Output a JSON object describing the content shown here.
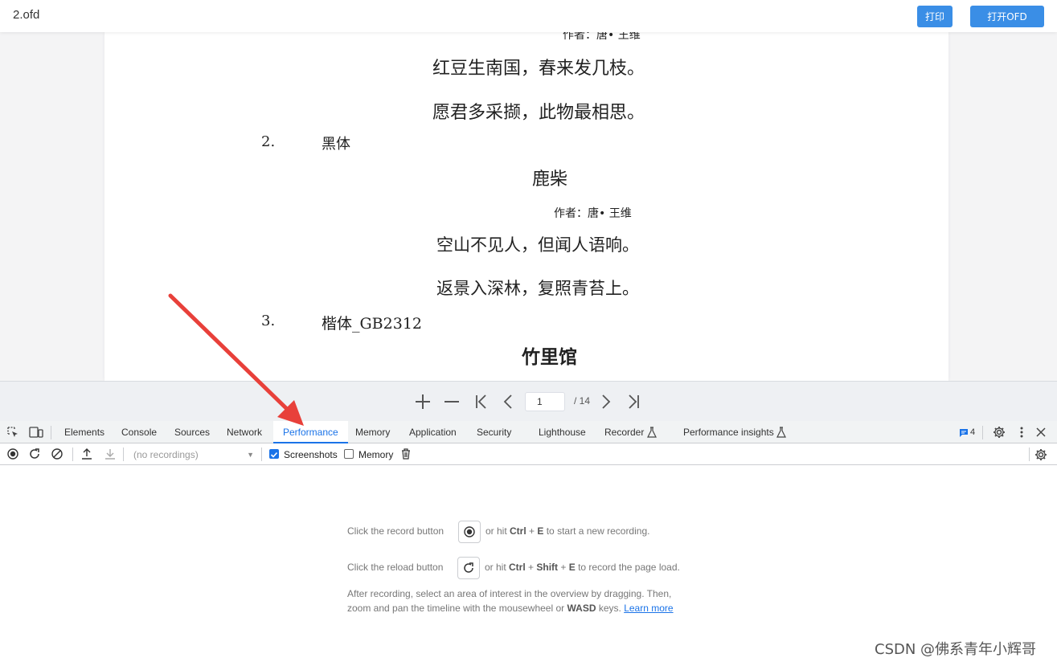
{
  "app": {
    "filename": "2.ofd",
    "print_label": "打印",
    "open_label": "打开OFD"
  },
  "document": {
    "author_partial": "作者：唐• 王维",
    "line1": "红豆生南国，春来发几枝。",
    "line2": "愿君多采撷，此物最相思。",
    "item2_num": "2.",
    "item2_label": "黑体",
    "poem2_title": "鹿柴",
    "poem2_author": "作者：唐• 王维",
    "poem2_line1": "空山不见人，但闻人语响。",
    "poem2_line2": "返景入深林，复照青苔上。",
    "item3_num": "3.",
    "item3_label": "楷体_GB2312",
    "poem3_title": "竹里馆"
  },
  "pager": {
    "page_value": "1",
    "total": "/ 14"
  },
  "devtools": {
    "tabs": [
      {
        "label": "Elements"
      },
      {
        "label": "Console"
      },
      {
        "label": "Sources"
      },
      {
        "label": "Network"
      },
      {
        "label": "Performance"
      },
      {
        "label": "Memory"
      },
      {
        "label": "Application"
      },
      {
        "label": "Security"
      },
      {
        "label": "Lighthouse"
      },
      {
        "label": "Recorder"
      },
      {
        "label": "Performance insights"
      }
    ],
    "issues_count": "4",
    "recordings_placeholder": "(no recordings)",
    "screenshots_label": "Screenshots",
    "memory_label": "Memory",
    "hint1_pre": "Click the record button",
    "hint1_post_a": "or hit ",
    "hint1_key1": "Ctrl",
    "hint1_plus": " + ",
    "hint1_key2": "E",
    "hint1_post_b": " to start a new recording.",
    "hint2_pre": "Click the reload button",
    "hint2_post_a": "or hit ",
    "hint2_key1": "Ctrl",
    "hint2_plus1": " + ",
    "hint2_key2": "Shift",
    "hint2_plus2": " + ",
    "hint2_key3": "E",
    "hint2_post_b": " to record the page load.",
    "hint3_line1": "After recording, select an area of interest in the overview by dragging. Then,",
    "hint3_line2_a": "zoom and pan the timeline with the mousewheel or ",
    "hint3_key": "WASD",
    "hint3_line2_b": " keys. ",
    "learn_more": "Learn more"
  },
  "watermark": "CSDN @佛系青年小辉哥",
  "colors": {
    "accent_blue": "#3a8ee6",
    "devtools_blue": "#1a73e8",
    "arrow_red": "#e8403a"
  }
}
